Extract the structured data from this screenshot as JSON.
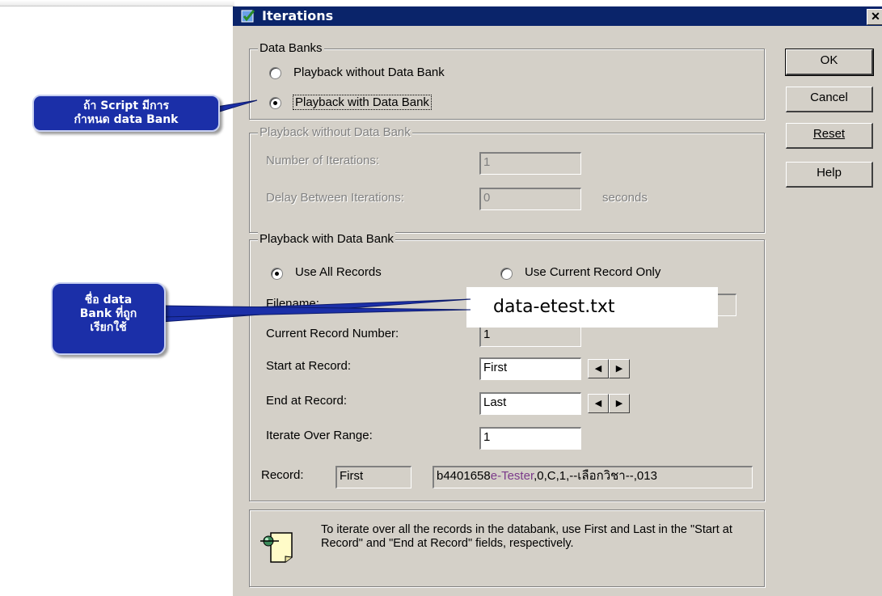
{
  "dialog": {
    "title": "Iterations",
    "close_glyph": "✕",
    "buttons": {
      "ok": "OK",
      "cancel": "Cancel",
      "reset": "Reset",
      "help": "Help"
    }
  },
  "data_banks": {
    "label": "Data Banks",
    "option_without": "Playback without Data Bank",
    "option_with": "Playback with Data Bank",
    "selected": "with"
  },
  "without_bank": {
    "label": "Playback without Data Bank",
    "iterations_label": "Number of Iterations:",
    "iterations_value": "1",
    "delay_label": "Delay Between Iterations:",
    "delay_value": "0",
    "delay_unit": "seconds"
  },
  "with_bank": {
    "label": "Playback with Data Bank",
    "use_all": "Use All Records",
    "use_current": "Use Current Record Only",
    "filename_label": "Filename:",
    "filename_value": "data-etest.txt",
    "current_label": "Current Record Number:",
    "current_value": "1",
    "start_label": "Start at Record:",
    "start_value": "First",
    "end_label": "End at Record:",
    "end_value": "Last",
    "range_label": "Iterate Over Range:",
    "range_value": "1",
    "record_label": "Record:",
    "record_position": "First",
    "record_content_prefix": "b4401658",
    "record_content_highlight": "e-Tester",
    "record_content_suffix": ",0,C,1,--เลือกวิชา--,013"
  },
  "info": {
    "icon": "pushpin-note-icon",
    "text": "To iterate over all the records in the databank, use First and Last in the \"Start at Record\" and \"End at Record\" fields, respectively."
  },
  "callouts": {
    "script_bank": "ถ้า Script มีการกำหนด data Bank",
    "bank_name": "ชื่อ data Bank ที่ถูกเรียกใช้"
  },
  "colors": {
    "dialog_bg": "#d4d0c8",
    "titlebar": "#0a246a",
    "callout_fill": "#1b2fa8",
    "highlight_text": "#7b3a8a"
  }
}
